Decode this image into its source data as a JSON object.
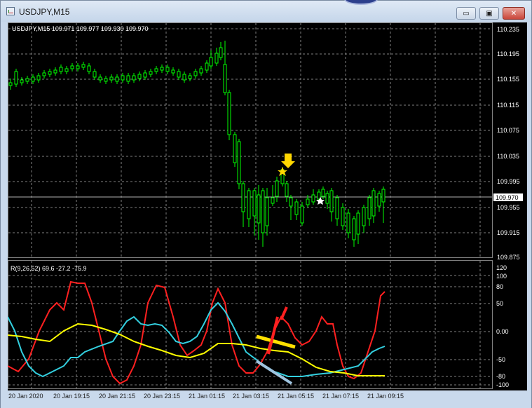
{
  "window": {
    "title": "USDJPY,M15",
    "buttons": {
      "minimize": "▭",
      "restore": "▣",
      "close": "✕"
    }
  },
  "chart": {
    "info_label": "USDJPY,M15  109.971 109.977 109.930 109.970",
    "current_price": "109.970",
    "price_ticks": [
      "110.235",
      "110.195",
      "110.155",
      "110.115",
      "110.075",
      "110.035",
      "109.995",
      "109.955",
      "109.915",
      "109.875"
    ],
    "indicator_label": "R(9,26,52) 69.6 -27.2 -75.9",
    "indicator_ticks": [
      "120",
      "100",
      "80",
      "50",
      "0.00",
      "-50",
      "-80",
      "-100"
    ],
    "time_ticks": [
      "20 Jan 2020",
      "20 Jan 19:15",
      "20 Jan 21:15",
      "20 Jan 23:15",
      "21 Jan 01:15",
      "21 Jan 03:15",
      "21 Jan 05:15",
      "21 Jan 07:15",
      "21 Jan 09:15"
    ],
    "colors": {
      "background": "#000000",
      "grid": "#808080",
      "candles": "#00ff00",
      "bull_body": "#ffffff",
      "rsi_fast": "#ff2020",
      "rsi_mid": "#33d0e0",
      "rsi_slow": "#ffff00",
      "signal_arrow": "#ffd700"
    }
  }
}
